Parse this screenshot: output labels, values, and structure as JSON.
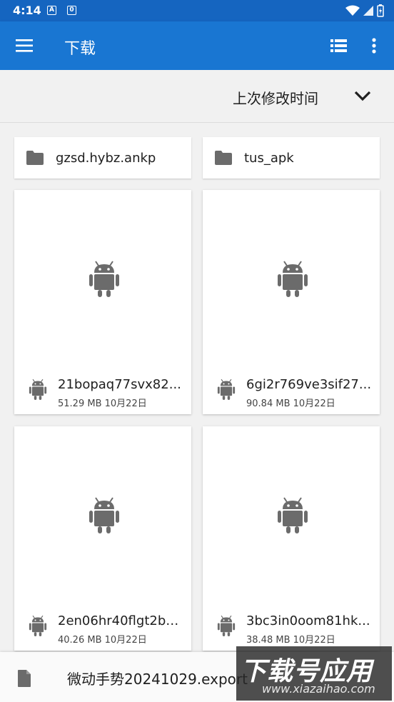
{
  "status_bar": {
    "time": "4:14",
    "notif_1": "A",
    "notif_2": "0"
  },
  "app_bar": {
    "title": "下载",
    "menu_icon": "hamburger-menu-icon",
    "list_view_icon": "list-view-icon",
    "more_icon": "more-vert-icon",
    "color": "#1976d2"
  },
  "sort": {
    "label": "上次修改时间",
    "icon": "chevron-down-icon"
  },
  "folders": [
    {
      "name": "gzsd.hybz.ankp"
    },
    {
      "name": "tus_apk"
    }
  ],
  "files": [
    {
      "name": "21bopaq77svx82...",
      "size": "51.29 MB",
      "date": "10月22日"
    },
    {
      "name": "6gi2r769ve3sif27...",
      "size": "90.84 MB",
      "date": "10月22日"
    },
    {
      "name": "2en06hr40flgt2bh...",
      "size": "40.26 MB",
      "date": "10月22日"
    },
    {
      "name": "3bc3in0oom81hk...",
      "size": "38.48 MB",
      "date": "10月22日"
    }
  ],
  "bottom_file": {
    "name": "微动手势20241029.export"
  },
  "watermark": {
    "text": "下载号应用",
    "url": "www.xiazaihao.com"
  }
}
